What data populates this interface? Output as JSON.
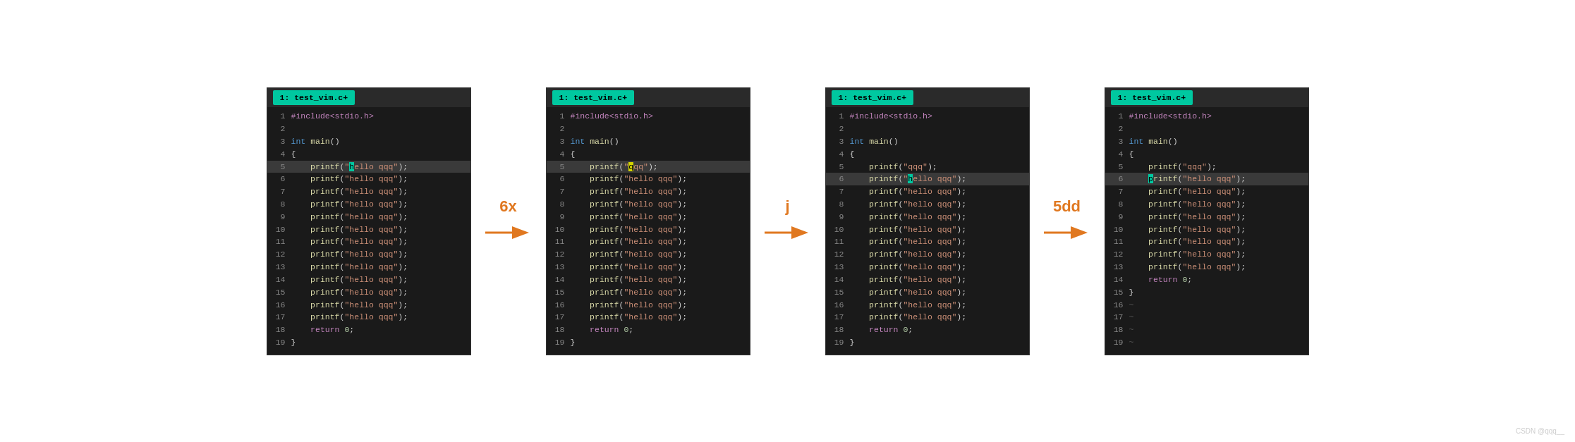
{
  "panels": [
    {
      "id": "panel1",
      "tab": "1: test_vim.c+",
      "lines": [
        {
          "num": "1",
          "content": "#include<stdio.h>",
          "type": "preprocessor"
        },
        {
          "num": "2",
          "content": "",
          "type": "default"
        },
        {
          "num": "3",
          "content": "int main()",
          "type": "main"
        },
        {
          "num": "4",
          "content": "{",
          "type": "brace"
        },
        {
          "num": "5",
          "content_html": "    printf(\"<hl>h</hl>ello qqq\");",
          "type": "highlight",
          "highlighted": true
        },
        {
          "num": "6",
          "content": "    printf(\"hello qqq\");",
          "type": "printf"
        },
        {
          "num": "7",
          "content": "    printf(\"hello qqq\");",
          "type": "printf"
        },
        {
          "num": "8",
          "content": "    printf(\"hello qqq\");",
          "type": "printf"
        },
        {
          "num": "9",
          "content": "    printf(\"hello qqq\");",
          "type": "printf"
        },
        {
          "num": "10",
          "content": "    printf(\"hello qqq\");",
          "type": "printf"
        },
        {
          "num": "11",
          "content": "    printf(\"hello qqq\");",
          "type": "printf"
        },
        {
          "num": "12",
          "content": "    printf(\"hello qqq\");",
          "type": "printf"
        },
        {
          "num": "13",
          "content": "    printf(\"hello qqq\");",
          "type": "printf"
        },
        {
          "num": "14",
          "content": "    printf(\"hello qqq\");",
          "type": "printf"
        },
        {
          "num": "15",
          "content": "    printf(\"hello qqq\");",
          "type": "printf"
        },
        {
          "num": "16",
          "content": "    printf(\"hello qqq\");",
          "type": "printf"
        },
        {
          "num": "17",
          "content": "    printf(\"hello qqq\");",
          "type": "printf"
        },
        {
          "num": "18",
          "content": "    return 0;",
          "type": "return"
        },
        {
          "num": "19",
          "content": "}",
          "type": "brace"
        }
      ]
    },
    {
      "id": "panel2",
      "tab": "1: test_vim.c+",
      "lines": [
        {
          "num": "1",
          "content": "#include<stdio.h>",
          "type": "preprocessor"
        },
        {
          "num": "2",
          "content": "",
          "type": "default"
        },
        {
          "num": "3",
          "content": "int main()",
          "type": "main"
        },
        {
          "num": "4",
          "content": "{",
          "type": "brace"
        },
        {
          "num": "5",
          "content_special": "panel2line5",
          "type": "highlight",
          "highlighted": true
        },
        {
          "num": "6",
          "content": "    printf(\"hello qqq\");",
          "type": "printf"
        },
        {
          "num": "7",
          "content": "    printf(\"hello qqq\");",
          "type": "printf"
        },
        {
          "num": "8",
          "content": "    printf(\"hello qqq\");",
          "type": "printf"
        },
        {
          "num": "9",
          "content": "    printf(\"hello qqq\");",
          "type": "printf"
        },
        {
          "num": "10",
          "content": "    printf(\"hello qqq\");",
          "type": "printf"
        },
        {
          "num": "11",
          "content": "    printf(\"hello qqq\");",
          "type": "printf"
        },
        {
          "num": "12",
          "content": "    printf(\"hello qqq\");",
          "type": "printf"
        },
        {
          "num": "13",
          "content": "    printf(\"hello qqq\");",
          "type": "printf"
        },
        {
          "num": "14",
          "content": "    printf(\"hello qqq\");",
          "type": "printf"
        },
        {
          "num": "15",
          "content": "    printf(\"hello qqq\");",
          "type": "printf"
        },
        {
          "num": "16",
          "content": "    printf(\"hello qqq\");",
          "type": "printf"
        },
        {
          "num": "17",
          "content": "    printf(\"hello qqq\");",
          "type": "printf"
        },
        {
          "num": "18",
          "content": "    return 0;",
          "type": "return"
        },
        {
          "num": "19",
          "content": "}",
          "type": "brace"
        }
      ]
    },
    {
      "id": "panel3",
      "tab": "1: test_vim.c+",
      "lines": [
        {
          "num": "1",
          "content": "#include<stdio.h>",
          "type": "preprocessor"
        },
        {
          "num": "2",
          "content": "",
          "type": "default"
        },
        {
          "num": "3",
          "content": "int main()",
          "type": "main"
        },
        {
          "num": "4",
          "content": "{",
          "type": "brace"
        },
        {
          "num": "5",
          "content": "    printf(\"qqq\");",
          "type": "printf"
        },
        {
          "num": "6",
          "content_special": "panel3line6",
          "type": "highlight",
          "highlighted": true
        },
        {
          "num": "7",
          "content": "    printf(\"hello qqq\");",
          "type": "printf"
        },
        {
          "num": "8",
          "content": "    printf(\"hello qqq\");",
          "type": "printf"
        },
        {
          "num": "9",
          "content": "    printf(\"hello qqq\");",
          "type": "printf"
        },
        {
          "num": "10",
          "content": "    printf(\"hello qqq\");",
          "type": "printf"
        },
        {
          "num": "11",
          "content": "    printf(\"hello qqq\");",
          "type": "printf"
        },
        {
          "num": "12",
          "content": "    printf(\"hello qqq\");",
          "type": "printf"
        },
        {
          "num": "13",
          "content": "    printf(\"hello qqq\");",
          "type": "printf"
        },
        {
          "num": "14",
          "content": "    printf(\"hello qqq\");",
          "type": "printf"
        },
        {
          "num": "15",
          "content": "    printf(\"hello qqq\");",
          "type": "printf"
        },
        {
          "num": "16",
          "content": "    printf(\"hello qqq\");",
          "type": "printf"
        },
        {
          "num": "17",
          "content": "    printf(\"hello qqq\");",
          "type": "printf"
        },
        {
          "num": "18",
          "content": "    return 0;",
          "type": "return"
        },
        {
          "num": "19",
          "content": "}",
          "type": "brace"
        }
      ]
    },
    {
      "id": "panel4",
      "tab": "1: test_vim.c+",
      "lines": [
        {
          "num": "1",
          "content": "#include<stdio.h>",
          "type": "preprocessor"
        },
        {
          "num": "2",
          "content": "",
          "type": "default"
        },
        {
          "num": "3",
          "content": "int main()",
          "type": "main"
        },
        {
          "num": "4",
          "content": "{",
          "type": "brace"
        },
        {
          "num": "5",
          "content": "    printf(\"qqq\");",
          "type": "printf"
        },
        {
          "num": "6",
          "content_special": "panel4line6",
          "type": "highlight",
          "highlighted": true
        },
        {
          "num": "7",
          "content": "    printf(\"hello qqq\");",
          "type": "printf"
        },
        {
          "num": "8",
          "content": "    printf(\"hello qqq\");",
          "type": "printf"
        },
        {
          "num": "9",
          "content": "    printf(\"hello qqq\");",
          "type": "printf"
        },
        {
          "num": "10",
          "content": "    printf(\"hello qqq\");",
          "type": "printf"
        },
        {
          "num": "11",
          "content": "    printf(\"hello qqq\");",
          "type": "printf"
        },
        {
          "num": "12",
          "content": "    printf(\"hello qqq\");",
          "type": "printf"
        },
        {
          "num": "13",
          "content": "    printf(\"hello qqq\");",
          "type": "printf"
        },
        {
          "num": "14",
          "content": "    return 0;",
          "type": "return"
        },
        {
          "num": "15",
          "content": "}",
          "type": "brace"
        },
        {
          "num": "16",
          "content": "~",
          "type": "tilde"
        },
        {
          "num": "17",
          "content": "~",
          "type": "tilde"
        },
        {
          "num": "18",
          "content": "~",
          "type": "tilde"
        },
        {
          "num": "19",
          "content": "~",
          "type": "tilde"
        }
      ]
    }
  ],
  "arrows": [
    {
      "label": "6x"
    },
    {
      "label": "j"
    },
    {
      "label": "5dd"
    }
  ],
  "watermark": "CSDN @qqq__"
}
